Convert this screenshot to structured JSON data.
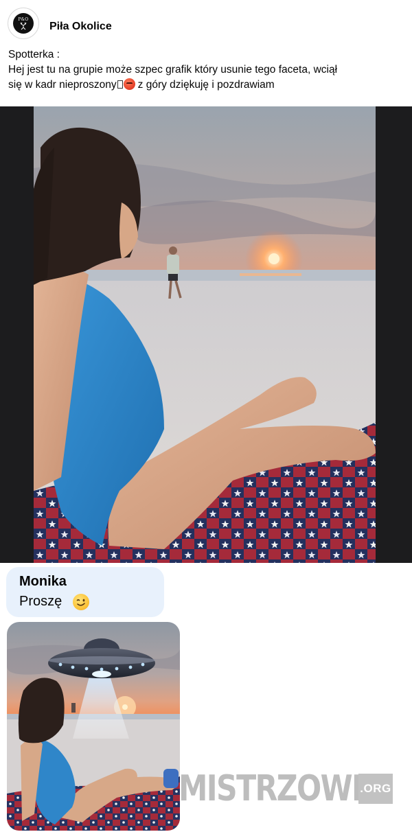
{
  "post": {
    "group_name": "Piła Okolice",
    "avatar_monogram": "P&O",
    "avatar_icon": "deer-logo",
    "text_line1": "Spotterka :",
    "text_line2": "Hej jest tu na grupie może szpec grafik który usunie tego faceta, wciął",
    "text_line3a": "się w kadr nieproszony",
    "text_line3b": "z góry dziękuję i pozdrawiam",
    "emoji_missing_glyph": "missing-glyph-icon",
    "emoji_angry": "angry-face-icon",
    "photo": "woman-on-beach-sunset-with-man-walking"
  },
  "comment": {
    "author": "Monika",
    "text": "Proszę",
    "emoji": "winking-face-icon"
  },
  "reply_image": {
    "subject": "woman-on-beach-with-ufo-abducting-man"
  },
  "watermark": {
    "word": "MISTRZOWIE",
    "tld": ".ORG"
  },
  "colors": {
    "swimsuit": "#2f86c9",
    "bubble": "#e8f1fc",
    "photo_border": "#1c1c1e",
    "watermark": "#bdbdbd"
  }
}
